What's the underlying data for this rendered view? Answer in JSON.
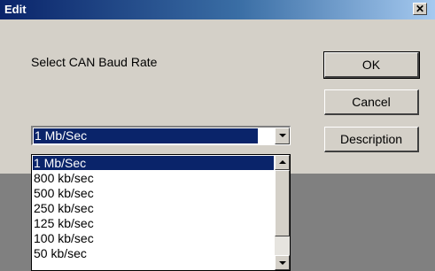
{
  "dialog": {
    "title": "Edit",
    "close_glyph": "✕",
    "prompt": "Select CAN Baud Rate"
  },
  "buttons": {
    "ok": "OK",
    "cancel": "Cancel",
    "description": "Description"
  },
  "combo": {
    "selected_value": "1 Mb/Sec"
  },
  "dropdown": {
    "items": [
      "1 Mb/Sec",
      "800 kb/sec",
      "500 kb/sec",
      "250 kb/sec",
      "125 kb/sec",
      "100 kb/sec",
      "50 kb/sec"
    ],
    "selected_index": 0
  },
  "colors": {
    "selection": "#0a246a",
    "face": "#d4d0c8"
  },
  "icons": {
    "close": "close-icon",
    "dropdown_arrow": "chevron-down-icon",
    "scroll_up": "scroll-up-icon",
    "scroll_down": "scroll-down-icon"
  }
}
